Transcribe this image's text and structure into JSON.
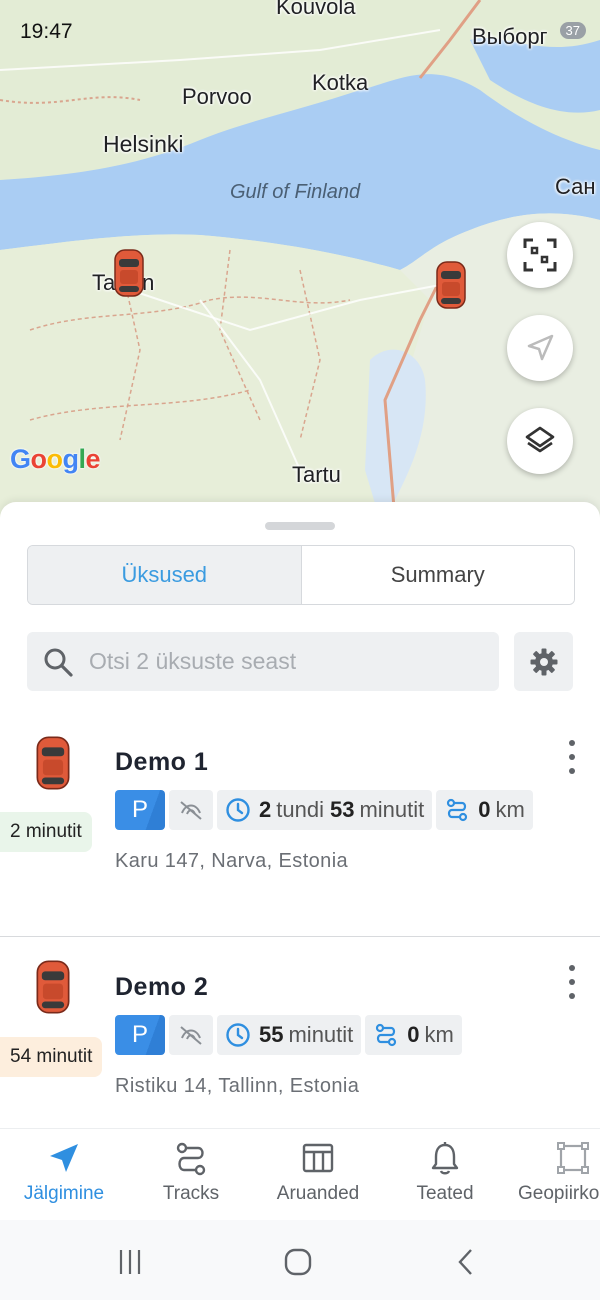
{
  "status_bar": {
    "time": "19:47",
    "battery": "37"
  },
  "map": {
    "labels": {
      "kouvola": "Kouvola",
      "porvoo": "Porvoo",
      "kotka": "Kotka",
      "helsinki": "Helsinki",
      "gulf": "Gulf of Finland",
      "vyborg": "Выборг",
      "san": "Сан",
      "tallinn": "Tallinn",
      "tartu": "Tartu"
    },
    "attribution": [
      "G",
      "o",
      "o",
      "g",
      "l",
      "e"
    ],
    "buttons": [
      "fit-bounds-icon",
      "locate-icon",
      "layers-icon"
    ]
  },
  "tabs": {
    "units": "Üksused",
    "summary": "Summary",
    "active": "Üksused"
  },
  "search": {
    "placeholder": "Otsi 2 üksuste seast",
    "value": ""
  },
  "units": [
    {
      "name": "Demo 1",
      "age": "2 minutit",
      "age_color": "#e9f5ea",
      "parking_label": "P",
      "duration_hours": "2",
      "duration_hours_unit": "tundi",
      "duration_minutes": "53",
      "duration_minutes_unit": "minutit",
      "distance_value": "0",
      "distance_unit": "km",
      "address": "Karu 147, Narva, Estonia"
    },
    {
      "name": "Demo 2",
      "age": "54 minutit",
      "age_color": "#fdeedd",
      "parking_label": "P",
      "duration_minutes": "55",
      "duration_minutes_unit": "minutit",
      "distance_value": "0",
      "distance_unit": "km",
      "address": "Ristiku 14, Tallinn, Estonia"
    }
  ],
  "bottom_nav": [
    {
      "label": "Jälgimine",
      "icon": "navigation-arrow-icon",
      "active": true
    },
    {
      "label": "Tracks",
      "icon": "route-icon",
      "active": false
    },
    {
      "label": "Aruanded",
      "icon": "table-icon",
      "active": false
    },
    {
      "label": "Teated",
      "icon": "bell-icon",
      "active": false
    },
    {
      "label": "Geopiirkonnad",
      "icon": "geofence-icon",
      "active": false
    }
  ],
  "colors": {
    "accent": "#2f8fe0",
    "parking": "#3a8ee6",
    "car": "#e05a3a"
  }
}
